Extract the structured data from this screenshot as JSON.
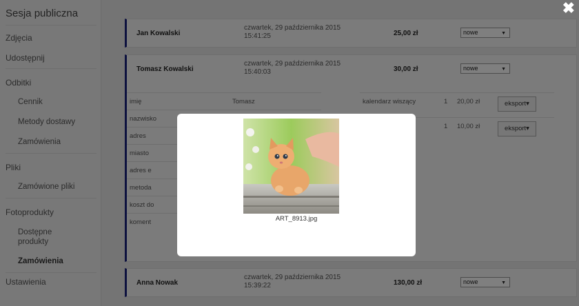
{
  "sidebar": {
    "title": "Sesja publiczna",
    "items": [
      {
        "label": "Zdjęcia"
      },
      {
        "label": "Udostępnij"
      },
      {
        "label": "Odbitki"
      },
      {
        "label": "Cennik"
      },
      {
        "label": "Metody dostawy"
      },
      {
        "label": "Zamówienia"
      },
      {
        "label": "Pliki"
      },
      {
        "label": "Zamówione pliki"
      },
      {
        "label": "Fotoprodukty"
      },
      {
        "label": "Dostępne produkty"
      },
      {
        "label": "Zamówienia"
      },
      {
        "label": "Ustawienia"
      }
    ]
  },
  "orders": [
    {
      "name": "Jan Kowalski",
      "date_line1": "czwartek, 29 października 2015",
      "date_line2": "15:41:25",
      "amount": "25,00 zł",
      "status": "nowe"
    },
    {
      "name": "Tomasz Kowalski",
      "date_line1": "czwartek, 29 października 2015",
      "date_line2": "15:40:03",
      "amount": "30,00 zł",
      "status": "nowe"
    },
    {
      "name": "Anna Nowak",
      "date_line1": "czwartek, 29 października 2015",
      "date_line2": "15:39:22",
      "amount": "130,00 zł",
      "status": "nowe"
    }
  ],
  "details": [
    {
      "label": "imię",
      "value": "Tomasz"
    },
    {
      "label": "nazwisko",
      "value": ""
    },
    {
      "label": "adres",
      "value": ""
    },
    {
      "label": "miasto",
      "value": ""
    },
    {
      "label": "adres e",
      "value": ""
    },
    {
      "label": "metoda",
      "value": ""
    },
    {
      "label": "koszt do",
      "value": ""
    },
    {
      "label": "koment",
      "value": ""
    }
  ],
  "items": [
    {
      "product": "kalendarz wiszący",
      "qty": "1",
      "price": "20,00 zł",
      "export_label": "eksport▾"
    },
    {
      "product": "",
      "qty": "1",
      "price": "10,00 zł",
      "export_label": "eksport▾"
    }
  ],
  "modal": {
    "filename": "ART_8913.jpg",
    "close_icon": "close-icon"
  }
}
